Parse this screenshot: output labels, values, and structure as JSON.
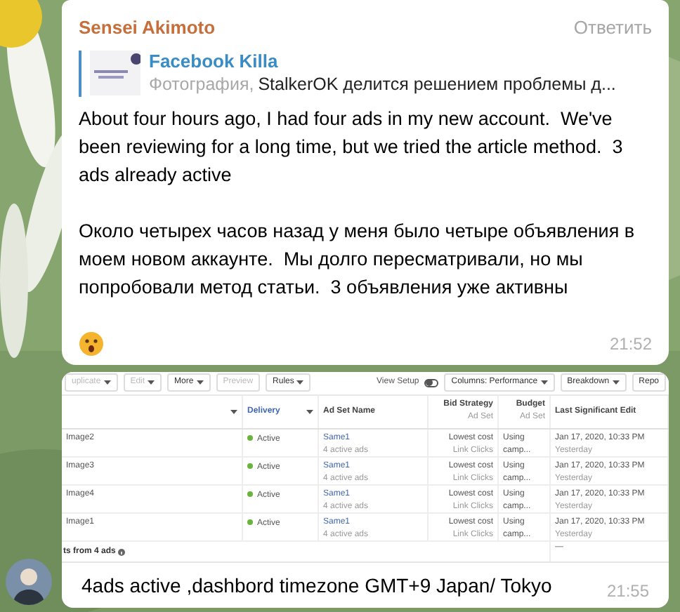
{
  "messages": [
    {
      "kind": "text",
      "sender": "Sensei Akimoto",
      "reply_action": "Ответить",
      "quote": {
        "title": "Facebook Killa",
        "media": "Фотография,",
        "text": "StalkerOK делится решением проблемы д..."
      },
      "paragraphs": [
        "About four hours ago, I had four ads in my new account.  We've been reviewing for a long time, but we tried the article method.  3 ads already active",
        "Около четырех часов назад у меня было четыре объявления в моем новом аккаунте.  Мы долго пересматривали, но мы попробовали метод статьи.  3 объявления уже активны"
      ],
      "time": "21:52"
    },
    {
      "kind": "screenshot",
      "caption": "4ads active ,dashbord timezone GMT+9 Japan/ Tokyo",
      "time": "21:55",
      "screenshot": {
        "toolbar": [
          {
            "label": "uplicate",
            "disabled": true,
            "menu": true
          },
          {
            "label": "Edit",
            "disabled": true,
            "menu": true
          },
          {
            "label": "More",
            "disabled": false,
            "menu": true
          },
          {
            "label": "Preview",
            "disabled": true,
            "menu": false
          },
          {
            "label": "Rules",
            "disabled": false,
            "menu": true
          }
        ],
        "view_setup": {
          "label": "View Setup",
          "on": false
        },
        "right_toolbar": [
          {
            "label": "Columns: Performance",
            "menu": true
          },
          {
            "label": "Breakdown",
            "menu": true
          },
          {
            "label": "Repo",
            "menu": false
          }
        ],
        "columns": [
          {
            "sortable": true
          },
          {
            "label": "Delivery",
            "sortable": true
          },
          {
            "label": "Ad Set Name",
            "sortable": false
          },
          {
            "label": "Bid Strategy",
            "sub": "Ad Set",
            "sortable": false
          },
          {
            "label": "Budget",
            "sub": "Ad Set",
            "sortable": false
          },
          {
            "label": "Last Significant Edit",
            "sortable": false
          }
        ],
        "rows": [
          {
            "name": "Image2",
            "delivery": "Active",
            "ad_set": "Same1",
            "ad_set_sub": "4 active ads",
            "bid": "Lowest cost",
            "bid_sub": "Link Clicks",
            "budget": "Using camp...",
            "edit": "Jan 17, 2020, 10:33 PM",
            "edit_sub": "Yesterday"
          },
          {
            "name": "Image3",
            "delivery": "Active",
            "ad_set": "Same1",
            "ad_set_sub": "4 active ads",
            "bid": "Lowest cost",
            "bid_sub": "Link Clicks",
            "budget": "Using camp...",
            "edit": "Jan 17, 2020, 10:33 PM",
            "edit_sub": "Yesterday"
          },
          {
            "name": "Image4",
            "delivery": "Active",
            "ad_set": "Same1",
            "ad_set_sub": "4 active ads",
            "bid": "Lowest cost",
            "bid_sub": "Link Clicks",
            "budget": "Using camp...",
            "edit": "Jan 17, 2020, 10:33 PM",
            "edit_sub": "Yesterday"
          },
          {
            "name": "Image1",
            "delivery": "Active",
            "ad_set": "Same1",
            "ad_set_sub": "4 active ads",
            "bid": "Lowest cost",
            "bid_sub": "Link Clicks",
            "budget": "Using camp...",
            "edit": "Jan 17, 2020, 10:33 PM",
            "edit_sub": "Yesterday"
          }
        ],
        "footer": {
          "label": "ts from 4 ads",
          "last": "—"
        }
      }
    }
  ]
}
